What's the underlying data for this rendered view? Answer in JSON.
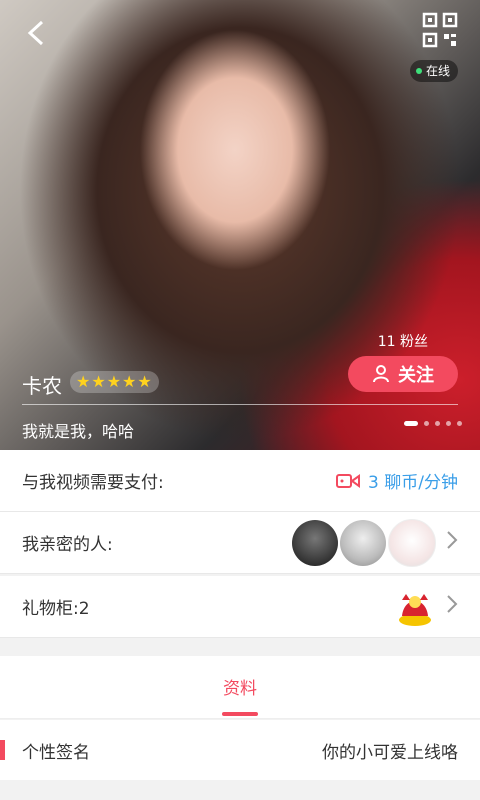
{
  "header": {
    "online_label": "在线",
    "fans_label": "11 粉丝",
    "follow_label": "关注",
    "name": "卡农",
    "stars": "★★★★★",
    "bio": "我就是我，哈哈"
  },
  "rows": {
    "video_label": "与我视频需要支付:",
    "video_value": "3 聊币/分钟",
    "intimate_label": "我亲密的人:",
    "gift_label": "礼物柜:2"
  },
  "tabs": {
    "active": "资料"
  },
  "profile": {
    "signature_label": "个性签名",
    "signature_value": "你的小可爱上线咯"
  },
  "colors": {
    "accent": "#f34a5f",
    "link": "#3a9ee8"
  }
}
